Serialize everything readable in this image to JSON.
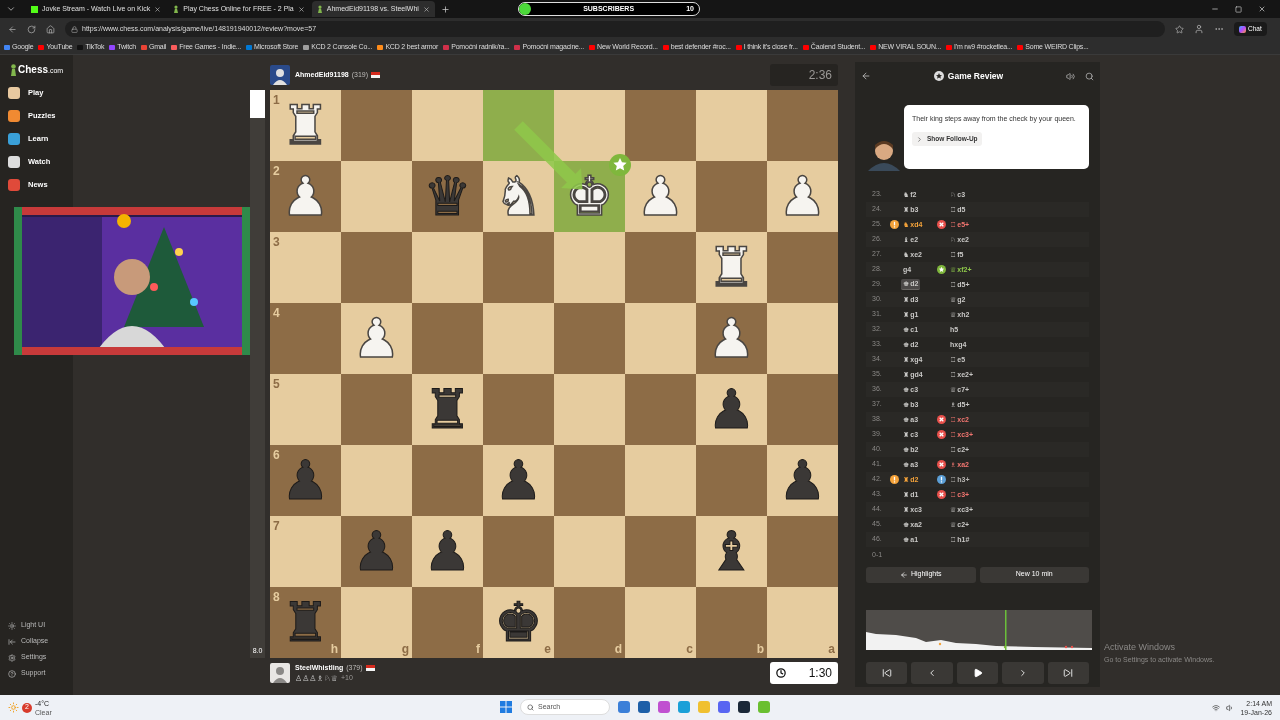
{
  "browser": {
    "tabs": [
      {
        "title": "Jovke Stream - Watch Live on Kick",
        "kind": "kick",
        "selected": false
      },
      {
        "title": "Play Chess Online for FREE - 2 Pla",
        "kind": "chess",
        "selected": false
      },
      {
        "title": "AhmedEid91198 vs. SteelWhi",
        "kind": "chess",
        "selected": true
      }
    ],
    "subscribers": {
      "label": "SUBSCRIBERS",
      "count": "10",
      "level": 0.05
    },
    "url": "https://www.chess.com/analysis/game/live/148191940012/review?move=57",
    "bookmarks": [
      {
        "label": "Google",
        "color": "#4285f4"
      },
      {
        "label": "YouTube",
        "color": "#ff0000"
      },
      {
        "label": "TikTok",
        "color": "#111111"
      },
      {
        "label": "Twitch",
        "color": "#9146ff"
      },
      {
        "label": "Gmail",
        "color": "#ea4335"
      },
      {
        "label": "Free Games - Indie...",
        "color": "#fa5c5c"
      },
      {
        "label": "Microsoft Store",
        "color": "#0078d4"
      },
      {
        "label": "KCD 2 Console Co...",
        "color": "#9e9e9e"
      },
      {
        "label": "KCD 2 best armor",
        "color": "#ff8c1a"
      },
      {
        "label": "Pomoćni radnik/ra...",
        "color": "#d0304a"
      },
      {
        "label": "Pomoćni magacine...",
        "color": "#d0304a"
      },
      {
        "label": "New World Record...",
        "color": "#ff0000"
      },
      {
        "label": "best defender #roc...",
        "color": "#ff0000"
      },
      {
        "label": "I think it's close fr...",
        "color": "#ff0000"
      },
      {
        "label": "Čaolend Student...",
        "color": "#ff0000"
      },
      {
        "label": "NEW VIRAL SOUN...",
        "color": "#ff0000"
      },
      {
        "label": "I'm rw9 #rocketlea...",
        "color": "#ff0000"
      },
      {
        "label": "Some WEIRD Clips...",
        "color": "#ff0000"
      }
    ],
    "chat": "Chat"
  },
  "sidebar": {
    "logo_main": "Chess",
    "logo_suffix": ".com",
    "items": [
      {
        "label": "Play",
        "color": "#e8c9a0"
      },
      {
        "label": "Puzzles",
        "color": "#f08a32"
      },
      {
        "label": "Learn",
        "color": "#3aa0d8"
      },
      {
        "label": "Watch",
        "color": "#dddddd"
      },
      {
        "label": "News",
        "color": "#e04a3a"
      }
    ],
    "bottom_items": [
      {
        "label": "Light UI",
        "kind": "theme"
      },
      {
        "label": "Collapse",
        "kind": "collapse"
      },
      {
        "label": "Settings",
        "kind": "settings"
      },
      {
        "label": "Support",
        "kind": "support"
      }
    ]
  },
  "eval_bar": {
    "level": 0.05,
    "reading": "8.0"
  },
  "top_player": {
    "name": "AhmedEid91198",
    "rating": "(319)",
    "clock": "2:36",
    "active": false
  },
  "board": {
    "files": [
      "h",
      "g",
      "f",
      "e",
      "d",
      "c",
      "b",
      "a"
    ],
    "rows": [
      {
        "rank": "1",
        "cells": [
          {
            "piece": "♜",
            "kind": "white",
            "highlighted": false
          },
          {
            "highlighted": false
          },
          {
            "highlighted": false
          },
          {
            "highlighted": true
          },
          {
            "highlighted": false
          },
          {
            "highlighted": false
          },
          {
            "highlighted": false
          },
          {
            "highlighted": false
          }
        ]
      },
      {
        "rank": "2",
        "cells": [
          {
            "piece": "♟",
            "kind": "white",
            "highlighted": false
          },
          {
            "highlighted": false
          },
          {
            "piece": "♛",
            "kind": "black",
            "highlighted": false
          },
          {
            "piece": "♞",
            "kind": "white",
            "highlighted": false
          },
          {
            "piece": "♚",
            "kind": "white",
            "highlighted": true,
            "best_move": true
          },
          {
            "piece": "♟",
            "kind": "white",
            "highlighted": false
          },
          {
            "highlighted": false
          },
          {
            "piece": "♟",
            "kind": "white",
            "highlighted": false
          }
        ]
      },
      {
        "rank": "3",
        "cells": [
          {
            "highlighted": false
          },
          {
            "highlighted": false
          },
          {
            "highlighted": false
          },
          {
            "highlighted": false
          },
          {
            "highlighted": false
          },
          {
            "highlighted": false
          },
          {
            "piece": "♜",
            "kind": "white",
            "highlighted": false
          },
          {
            "highlighted": false
          }
        ]
      },
      {
        "rank": "4",
        "cells": [
          {
            "highlighted": false
          },
          {
            "piece": "♟",
            "kind": "white",
            "highlighted": false
          },
          {
            "highlighted": false
          },
          {
            "highlighted": false
          },
          {
            "highlighted": false
          },
          {
            "highlighted": false
          },
          {
            "piece": "♟",
            "kind": "white",
            "highlighted": false
          },
          {
            "highlighted": false
          }
        ]
      },
      {
        "rank": "5",
        "cells": [
          {
            "highlighted": false
          },
          {
            "highlighted": false
          },
          {
            "piece": "♜",
            "kind": "black",
            "highlighted": false
          },
          {
            "highlighted": false
          },
          {
            "highlighted": false
          },
          {
            "highlighted": false
          },
          {
            "piece": "♟",
            "kind": "black",
            "highlighted": false
          },
          {
            "highlighted": false
          }
        ]
      },
      {
        "rank": "6",
        "cells": [
          {
            "piece": "♟",
            "kind": "black",
            "highlighted": false
          },
          {
            "highlighted": false
          },
          {
            "highlighted": false
          },
          {
            "piece": "♟",
            "kind": "black",
            "highlighted": false
          },
          {
            "highlighted": false
          },
          {
            "highlighted": false
          },
          {
            "highlighted": false
          },
          {
            "piece": "♟",
            "kind": "black",
            "highlighted": false
          }
        ]
      },
      {
        "rank": "7",
        "cells": [
          {
            "highlighted": false
          },
          {
            "piece": "♟",
            "kind": "black",
            "highlighted": false
          },
          {
            "piece": "♟",
            "kind": "black",
            "highlighted": false
          },
          {
            "highlighted": false
          },
          {
            "highlighted": false
          },
          {
            "highlighted": false
          },
          {
            "piece": "♝",
            "kind": "black",
            "highlighted": false
          },
          {
            "highlighted": false
          }
        ]
      },
      {
        "rank": "8",
        "cells": [
          {
            "piece": "♜",
            "kind": "black",
            "highlighted": false
          },
          {
            "highlighted": false
          },
          {
            "highlighted": false
          },
          {
            "piece": "♚",
            "kind": "black",
            "highlighted": false
          },
          {
            "highlighted": false
          },
          {
            "highlighted": false
          },
          {
            "highlighted": false
          },
          {
            "highlighted": false
          }
        ]
      }
    ]
  },
  "bottom_player": {
    "name": "SteelWhistling",
    "rating": "(379)",
    "captured": "♙♙♙♗♘♕",
    "advantage": "+10",
    "clock": "1:30",
    "active": true
  },
  "review": {
    "title": "Game Review",
    "coach_text": "Their king steps away from the check by your queen.",
    "follow_up": "Show Follow-Up",
    "moves": [
      {
        "number": "23.",
        "white": {
          "glyph": "♞",
          "san": "f2",
          "kind": "plain",
          "selected": false
        },
        "black": {
          "glyph": "♘",
          "san": "c3",
          "kind": "plain",
          "selected": false
        }
      },
      {
        "number": "24.",
        "white": {
          "glyph": "♜",
          "san": "b3",
          "kind": "plain",
          "selected": false
        },
        "black": {
          "glyph": "♖",
          "san": "d5",
          "kind": "plain",
          "selected": false
        }
      },
      {
        "number": "25.",
        "white": {
          "glyph": "♞",
          "san": "xd4",
          "kind": "mistake",
          "selected": false
        },
        "black": {
          "glyph": "♖",
          "san": "e5+",
          "kind": "blunder",
          "selected": false
        }
      },
      {
        "number": "26.",
        "white": {
          "glyph": "♝",
          "san": "e2",
          "kind": "plain",
          "selected": false
        },
        "black": {
          "glyph": "♘",
          "san": "xe2",
          "kind": "plain",
          "selected": false
        }
      },
      {
        "number": "27.",
        "white": {
          "glyph": "♞",
          "san": "xe2",
          "kind": "plain",
          "selected": false
        },
        "black": {
          "glyph": "♖",
          "san": "f5",
          "kind": "plain",
          "selected": false
        }
      },
      {
        "number": "28.",
        "white": {
          "san": "g4",
          "kind": "plain",
          "selected": false
        },
        "black": {
          "glyph": "♕",
          "san": "xf2+",
          "kind": "best",
          "selected": false
        }
      },
      {
        "number": "29.",
        "white": {
          "glyph": "♚",
          "san": "d2",
          "kind": "plain",
          "selected": true
        },
        "black": {
          "glyph": "♖",
          "san": "d5+",
          "kind": "plain",
          "selected": false
        }
      },
      {
        "number": "30.",
        "white": {
          "glyph": "♜",
          "san": "d3",
          "kind": "plain",
          "selected": false
        },
        "black": {
          "glyph": "♕",
          "san": "g2",
          "kind": "plain",
          "selected": false
        }
      },
      {
        "number": "31.",
        "white": {
          "glyph": "♜",
          "san": "g1",
          "kind": "plain",
          "selected": false
        },
        "black": {
          "glyph": "♕",
          "san": "xh2",
          "kind": "plain",
          "selected": false
        }
      },
      {
        "number": "32.",
        "white": {
          "glyph": "♚",
          "san": "c1",
          "kind": "plain",
          "selected": false
        },
        "black": {
          "san": "h5",
          "kind": "plain",
          "selected": false
        }
      },
      {
        "number": "33.",
        "white": {
          "glyph": "♚",
          "san": "d2",
          "kind": "plain",
          "selected": false
        },
        "black": {
          "san": "hxg4",
          "kind": "plain",
          "selected": false
        }
      },
      {
        "number": "34.",
        "white": {
          "glyph": "♜",
          "san": "xg4",
          "kind": "plain",
          "selected": false
        },
        "black": {
          "glyph": "♖",
          "san": "e5",
          "kind": "plain",
          "selected": false
        }
      },
      {
        "number": "35.",
        "white": {
          "glyph": "♜",
          "san": "gd4",
          "kind": "plain",
          "selected": false
        },
        "black": {
          "glyph": "♖",
          "san": "xe2+",
          "kind": "plain",
          "selected": false
        }
      },
      {
        "number": "36.",
        "white": {
          "glyph": "♚",
          "san": "c3",
          "kind": "plain",
          "selected": false
        },
        "black": {
          "glyph": "♕",
          "san": "c7+",
          "kind": "plain",
          "selected": false
        }
      },
      {
        "number": "37.",
        "white": {
          "glyph": "♚",
          "san": "b3",
          "kind": "plain",
          "selected": false
        },
        "black": {
          "glyph": "♗",
          "san": "d5+",
          "kind": "plain",
          "selected": false
        }
      },
      {
        "number": "38.",
        "white": {
          "glyph": "♚",
          "san": "a3",
          "kind": "plain",
          "selected": false
        },
        "black": {
          "glyph": "♖",
          "san": "xc2",
          "kind": "blunder",
          "selected": false
        }
      },
      {
        "number": "39.",
        "white": {
          "glyph": "♜",
          "san": "c3",
          "kind": "plain",
          "selected": false
        },
        "black": {
          "glyph": "♖",
          "san": "xc3+",
          "kind": "blunder",
          "selected": false
        }
      },
      {
        "number": "40.",
        "white": {
          "glyph": "♚",
          "san": "b2",
          "kind": "plain",
          "selected": false
        },
        "black": {
          "glyph": "♖",
          "san": "c2+",
          "kind": "plain",
          "selected": false
        }
      },
      {
        "number": "41.",
        "white": {
          "glyph": "♚",
          "san": "a3",
          "kind": "plain",
          "selected": false
        },
        "black": {
          "glyph": "♗",
          "san": "xa2",
          "kind": "blunder",
          "selected": false
        }
      },
      {
        "number": "42.",
        "white": {
          "glyph": "♜",
          "san": "d2",
          "kind": "mistake",
          "selected": false
        },
        "black": {
          "glyph": "♖",
          "san": "h3+",
          "kind": "great",
          "selected": false
        }
      },
      {
        "number": "43.",
        "white": {
          "glyph": "♜",
          "san": "d1",
          "kind": "plain",
          "selected": false
        },
        "black": {
          "glyph": "♖",
          "san": "c3+",
          "kind": "blunder",
          "selected": false
        }
      },
      {
        "number": "44.",
        "white": {
          "glyph": "♜",
          "san": "xc3",
          "kind": "plain",
          "selected": false
        },
        "black": {
          "glyph": "♕",
          "san": "xc3+",
          "kind": "plain",
          "selected": false
        }
      },
      {
        "number": "45.",
        "white": {
          "glyph": "♚",
          "san": "xa2",
          "kind": "plain",
          "selected": false
        },
        "black": {
          "glyph": "♕",
          "san": "c2+",
          "kind": "plain",
          "selected": false
        }
      },
      {
        "number": "46.",
        "white": {
          "glyph": "♚",
          "san": "a1",
          "kind": "plain",
          "selected": false
        },
        "black": {
          "glyph": "♖",
          "san": "h1#",
          "kind": "plain",
          "selected": false
        }
      }
    ],
    "result": "0-1",
    "highlights": "Highlights",
    "new_game": "New 10 min"
  },
  "activation": {
    "title": "Activate Windows",
    "text": "Go to Settings to activate Windows."
  },
  "taskbar": {
    "weather_badge": "2",
    "temperature": "-4°C",
    "condition": "Clear",
    "search": "Search",
    "time": "2:14 AM",
    "date": "19-Jan-26"
  }
}
